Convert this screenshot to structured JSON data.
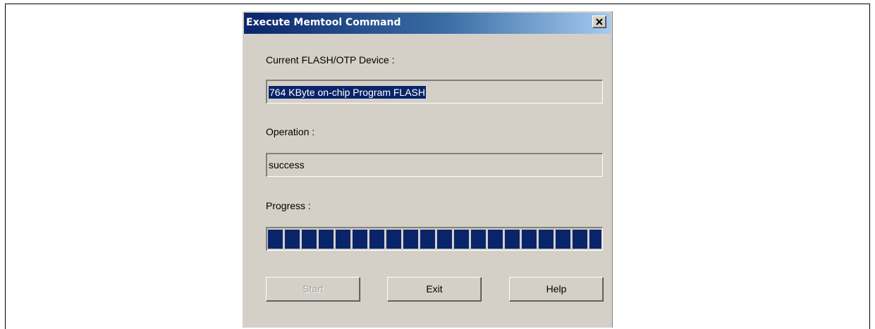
{
  "window": {
    "title": "Execute Memtool Command",
    "close_icon": "close-icon"
  },
  "device": {
    "label": "Current FLASH/OTP Device :",
    "value": "764 KByte on-chip Program FLASH"
  },
  "operation": {
    "label": "Operation :",
    "value": "success"
  },
  "progress": {
    "label": "Progress :",
    "percent": 100
  },
  "buttons": {
    "start": "Start",
    "exit": "Exit",
    "help": "Help"
  },
  "colors": {
    "titlebar_start": "#0a246a",
    "titlebar_end": "#a6caf0",
    "progress_fill": "#0a246a",
    "dialog_bg": "#d4d0c8"
  }
}
